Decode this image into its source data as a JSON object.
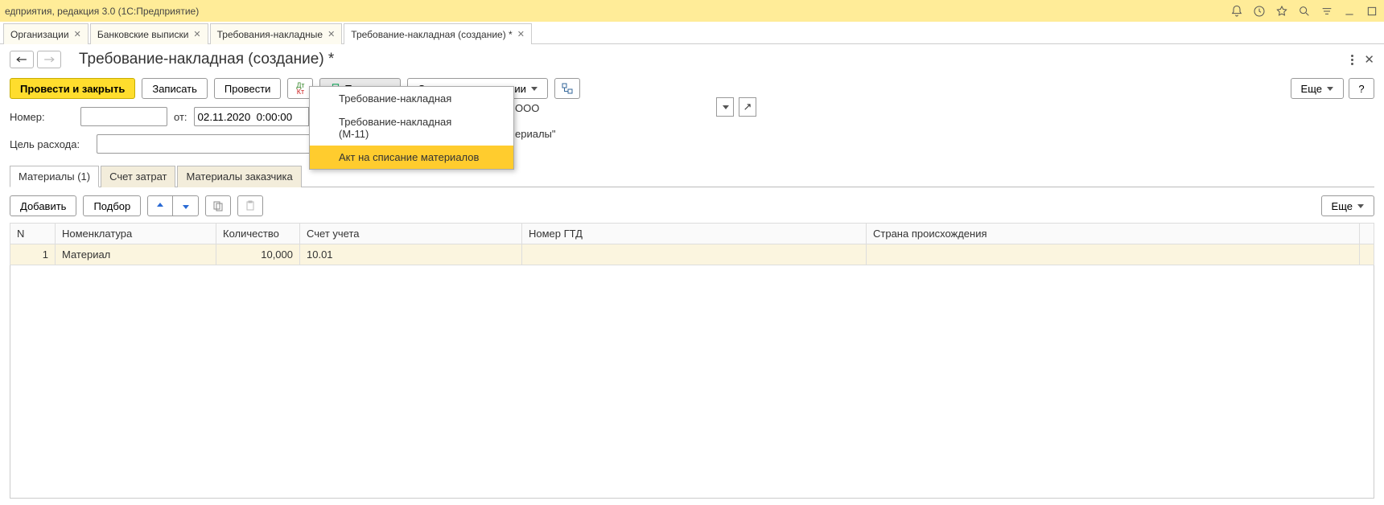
{
  "titlebar": {
    "title": "едприятия, редакция 3.0  (1С:Предприятие)"
  },
  "tabs": [
    {
      "label": "Организации",
      "closable": true
    },
    {
      "label": "Банковские выписки",
      "closable": true
    },
    {
      "label": "Требования-накладные",
      "closable": true
    },
    {
      "label": "Требование-накладная (создание) *",
      "closable": true,
      "active": true
    }
  ],
  "page": {
    "title": "Требование-накладная (создание) *"
  },
  "toolbar": {
    "post_and_close": "Провести и закрыть",
    "save": "Записать",
    "post": "Провести",
    "print": "Печать",
    "create_based_on": "Создать на основании",
    "more": "Еще",
    "help": "?"
  },
  "print_menu": {
    "item1": "Требование-накладная",
    "item2": "Требование-накладная (М-11)",
    "item3": "Акт на списание материалов"
  },
  "form": {
    "number_label": "Номер:",
    "from_label": "от:",
    "date_value": "02.11.2020  0:00:00",
    "purpose_label": "Цель расхода:",
    "org_partial_value": "ООО",
    "warehouse_suffix": "ериалы\""
  },
  "subtabs": {
    "materials": "Материалы (1)",
    "cost_account": "Счет затрат",
    "customer_materials": "Материалы заказчика"
  },
  "table_toolbar": {
    "add": "Добавить",
    "pick": "Подбор",
    "more": "Еще"
  },
  "table": {
    "headers": {
      "n": "N",
      "nomenclature": "Номенклатура",
      "quantity": "Количество",
      "account": "Счет учета",
      "gtd": "Номер ГТД",
      "origin": "Страна происхождения"
    },
    "rows": [
      {
        "n": "1",
        "nomenclature": "Материал",
        "quantity": "10,000",
        "account": "10.01",
        "gtd": "",
        "origin": ""
      }
    ]
  }
}
